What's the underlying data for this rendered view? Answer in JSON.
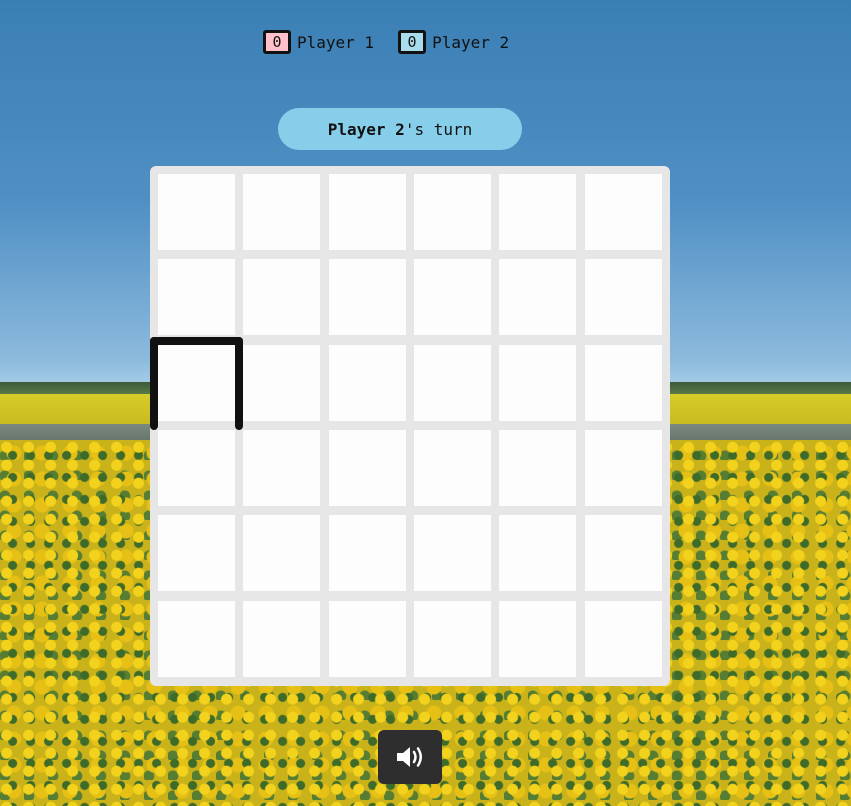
{
  "scoreboard": {
    "player1": {
      "score": "0",
      "name": "Player 1",
      "color": "#ffc0cb"
    },
    "player2": {
      "score": "0",
      "name": "Player 2",
      "color": "#a8dced"
    }
  },
  "turn": {
    "player": "Player 2",
    "suffix": "'s turn",
    "banner_color": "#87ceeb"
  },
  "board": {
    "rows": 6,
    "cols": 6,
    "drawn_edges": [
      {
        "type": "horizontal",
        "row": 2,
        "col": 0
      },
      {
        "type": "vertical",
        "row": 2,
        "col": 0
      },
      {
        "type": "vertical",
        "row": 2,
        "col": 1
      }
    ],
    "line_color": "#111111",
    "cell_color": "#fdfdfd",
    "grid_color": "#e6e6e6"
  },
  "controls": {
    "sound_icon": "volume-icon"
  }
}
